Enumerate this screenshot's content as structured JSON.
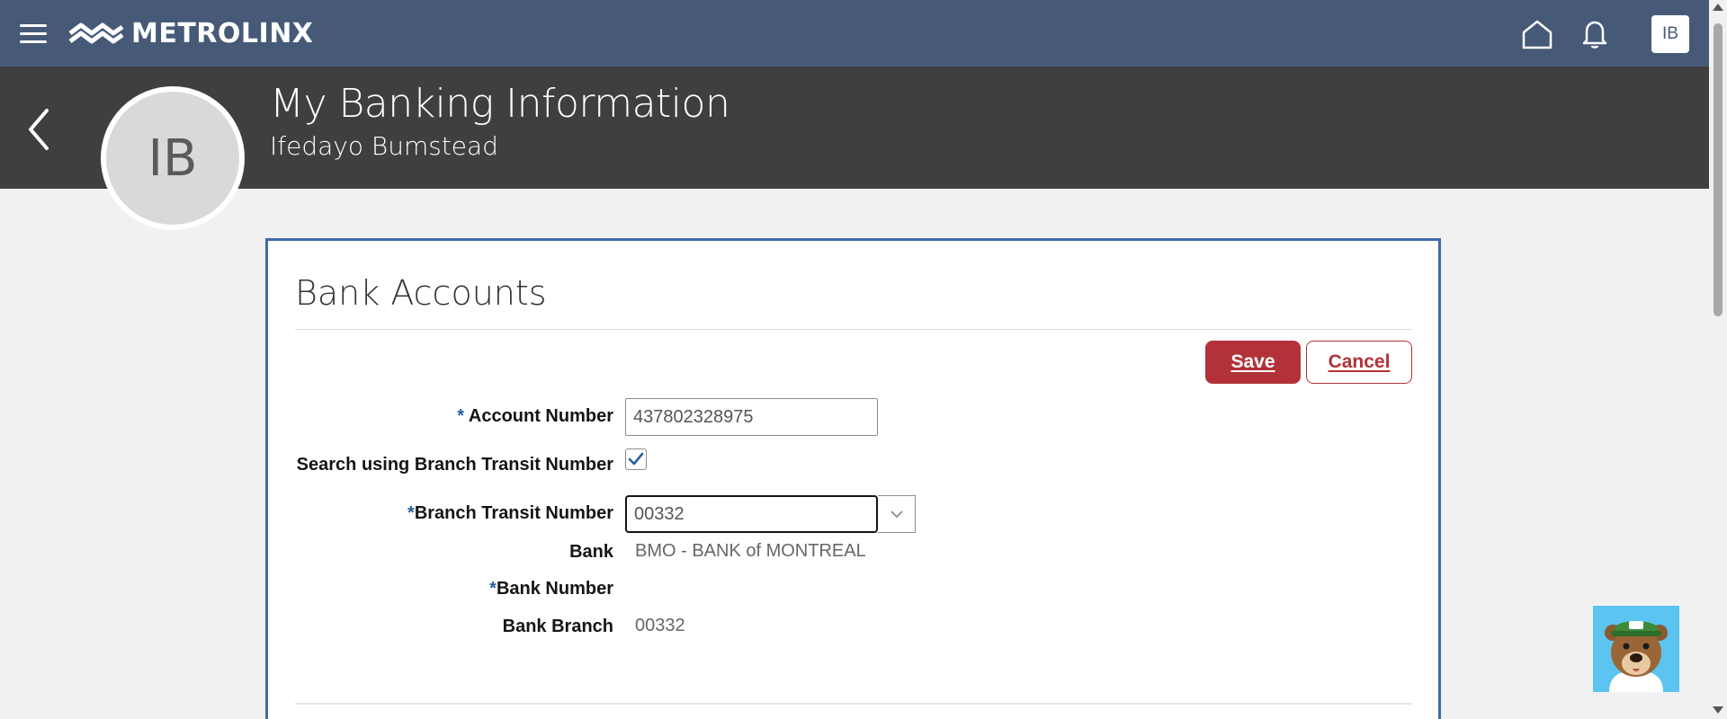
{
  "topbar": {
    "logo_text": "METROLINX",
    "user_initials": "IB",
    "icons": [
      "menu-icon",
      "home-icon",
      "bell-icon"
    ],
    "background": "#465a78"
  },
  "header": {
    "title": "My Banking Information",
    "subtitle": "Ifedayo Bumstead",
    "avatar_initials": "IB",
    "background": "#3f3f3f"
  },
  "card": {
    "title": "Bank Accounts",
    "save_label": "Save",
    "cancel_label": "Cancel",
    "accent": "#b3323a",
    "border": "#3f6aa8"
  },
  "form": {
    "required_mark": "*",
    "account_number": {
      "label": "Account Number",
      "value": "437802328975"
    },
    "search_branch": {
      "label": "Search using Branch Transit Number",
      "checked": true
    },
    "branch_transit": {
      "label": "Branch Transit Number",
      "value": "00332"
    },
    "bank": {
      "label": "Bank",
      "value": "BMO - BANK of MONTREAL"
    },
    "bank_number": {
      "label": "Bank Number",
      "value": ""
    },
    "bank_branch": {
      "label": "Bank Branch",
      "value": "00332"
    }
  }
}
